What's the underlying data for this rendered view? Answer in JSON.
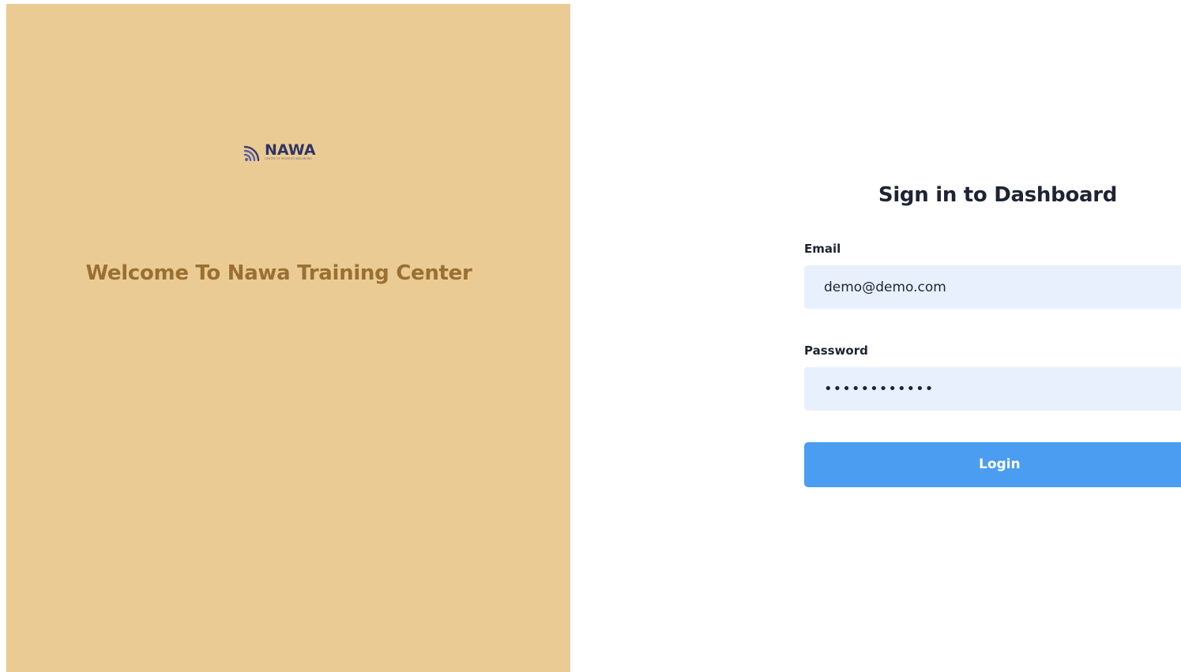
{
  "branding": {
    "logo_icon": "signal-waves-icon",
    "logo_text": "NAWA",
    "logo_tagline": "CENTRE OF WOMEN'S WELLBEING",
    "welcome_text": "Welcome To Nawa Training Center",
    "panel_color": "#eacb93",
    "welcome_color": "#9a7032",
    "logo_color": "#2f3563",
    "icon_color": "#5b5fa8"
  },
  "login_form": {
    "title": "Sign in to Dashboard",
    "email": {
      "label": "Email",
      "value": "demo@demo.com"
    },
    "password": {
      "label": "Password",
      "value": "••••••••••••"
    },
    "submit_label": "Login",
    "input_background": "#e8f0fe",
    "button_color": "#4a9df0"
  }
}
